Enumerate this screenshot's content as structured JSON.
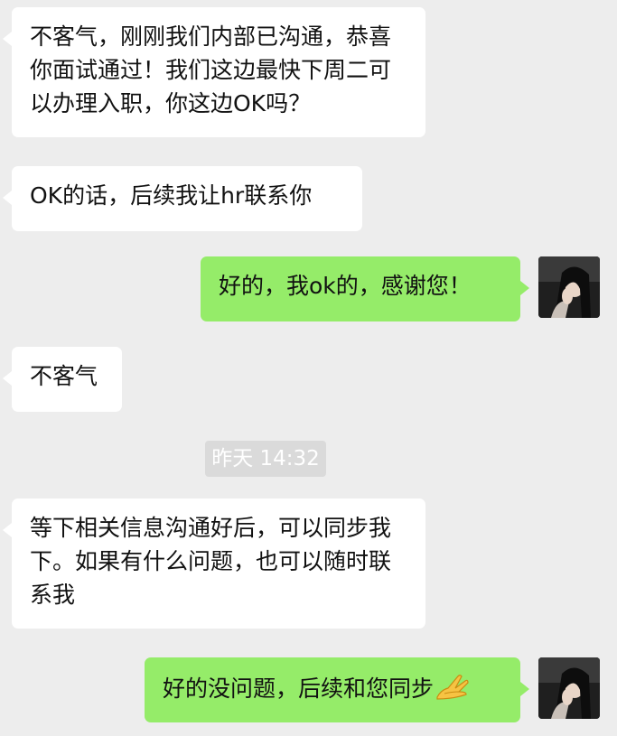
{
  "messages": [
    {
      "side": "left",
      "text": "不客气，刚刚我们内部已沟通，恭喜你面试通过！我们这边最快下周二可以办理入职，你这边OK吗？"
    },
    {
      "side": "left",
      "text": "OK的话，后续我让hr联系你"
    },
    {
      "side": "right",
      "text": "好的，我ok的，感谢您！"
    },
    {
      "side": "left",
      "text": "不客气"
    },
    {
      "side": "left",
      "text": "等下相关信息沟通好后，可以同步我下。如果有什么问题，也可以随时联系我"
    },
    {
      "side": "right",
      "text": "好的没问题，后续和您同步",
      "emoji": "ok-hand-gesture-icon"
    }
  ],
  "timestamp": "昨天 14:32",
  "colors": {
    "background": "#EDEDED",
    "incoming_bubble": "#FFFFFF",
    "outgoing_bubble": "#95EC69",
    "timestamp_bg": "#DADADA"
  }
}
